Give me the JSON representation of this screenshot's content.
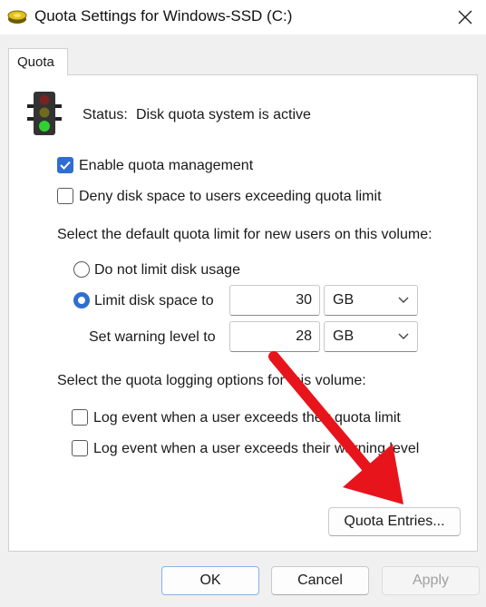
{
  "window": {
    "title": "Quota Settings for Windows-SSD (C:)"
  },
  "tabs": [
    {
      "label": "Quota"
    }
  ],
  "status": {
    "label": "Status:",
    "value": "Disk quota system is active"
  },
  "options": {
    "enable_quota": {
      "label": "Enable quota management",
      "checked": true
    },
    "deny_space": {
      "label": "Deny disk space to users exceeding quota limit",
      "checked": false
    }
  },
  "default_limit": {
    "heading": "Select the default quota limit for new users on this volume:",
    "no_limit": {
      "label": "Do not limit disk usage",
      "selected": false
    },
    "limit": {
      "label": "Limit disk space to",
      "selected": true,
      "value": "30",
      "unit": "GB"
    },
    "warning": {
      "label": "Set warning level to",
      "value": "28",
      "unit": "GB"
    }
  },
  "logging": {
    "heading": "Select the quota logging options for this volume:",
    "over_limit": {
      "label": "Log event when a user exceeds their quota limit",
      "checked": false
    },
    "over_warning": {
      "label": "Log event when a user exceeds their warning level",
      "checked": false
    }
  },
  "buttons": {
    "quota_entries": "Quota Entries...",
    "ok": "OK",
    "cancel": "Cancel",
    "apply": "Apply"
  },
  "colors": {
    "accent": "#2f6ed0",
    "annotation_arrow": "#e8141c"
  }
}
